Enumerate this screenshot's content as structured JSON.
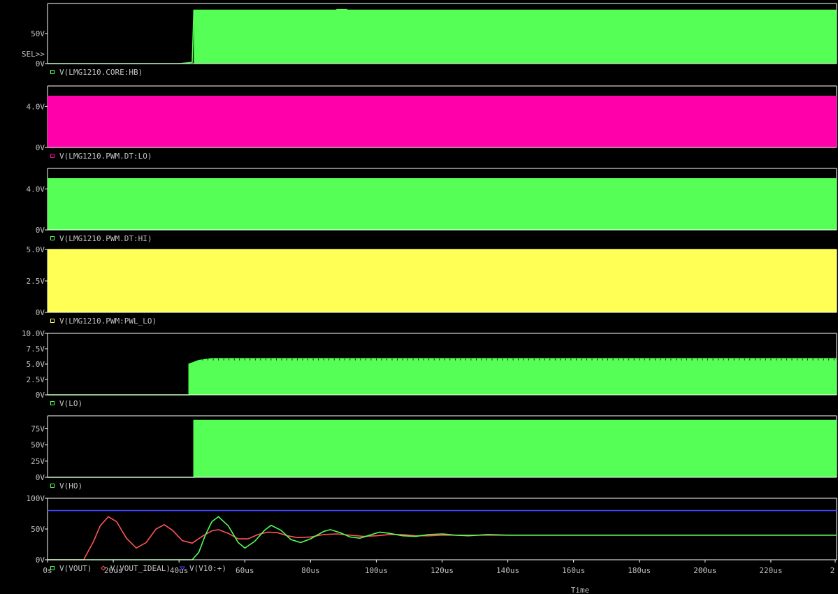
{
  "window": {
    "sel_marker": "SEL>>"
  },
  "x_axis": {
    "title": "Time",
    "ticks": [
      "0s",
      "20us",
      "40us",
      "60us",
      "80us",
      "100us",
      "120us",
      "140us",
      "160us",
      "180us",
      "200us",
      "220us",
      "2"
    ]
  },
  "colors": {
    "background": "#000000",
    "frame": "#ffffff",
    "axis_text": "#c0c0c0",
    "green": "#55ff55",
    "magenta": "#ff00aa",
    "yellow": "#ffff55",
    "red": "#ff5555",
    "blue": "#4444ff"
  },
  "chart_data": [
    {
      "type": "area",
      "ylim": [
        0,
        100
      ],
      "y_ticks": [
        "50V",
        "0V"
      ],
      "y_tick_values": [
        50,
        0
      ],
      "legend": [
        {
          "name": "V(LMG1210.CORE:HB)",
          "color": "green",
          "marker": "square"
        }
      ],
      "series": [
        {
          "name": "V(LMG1210.CORE:HB)",
          "color": "green",
          "envelope": [
            [
              0,
              0
            ],
            [
              40,
              0
            ],
            [
              44,
              2
            ],
            [
              44.5,
              89
            ],
            [
              88,
              89
            ],
            [
              88,
              90
            ],
            [
              91,
              90
            ],
            [
              91,
              89
            ],
            [
              240,
              89
            ]
          ],
          "fill_low": 0,
          "fill_start": 44.5
        }
      ]
    },
    {
      "type": "area",
      "ylim": [
        0,
        6
      ],
      "y_ticks": [
        "4.0V",
        "0V"
      ],
      "y_tick_values": [
        4,
        0
      ],
      "legend": [
        {
          "name": "V(LMG1210.PWM.DT:LO)",
          "color": "magenta",
          "marker": "square"
        }
      ],
      "series": [
        {
          "name": "V(LMG1210.PWM.DT:LO)",
          "color": "magenta",
          "envelope": [
            [
              0,
              5
            ],
            [
              240,
              5
            ]
          ],
          "fill_low": 0,
          "fill_start": 0
        }
      ]
    },
    {
      "type": "area",
      "ylim": [
        0,
        6
      ],
      "y_ticks": [
        "4.0V",
        "0V"
      ],
      "y_tick_values": [
        4,
        0
      ],
      "legend": [
        {
          "name": "V(LMG1210.PWM.DT:HI)",
          "color": "green",
          "marker": "square"
        }
      ],
      "series": [
        {
          "name": "V(LMG1210.PWM.DT:HI)",
          "color": "green",
          "envelope": [
            [
              0,
              5
            ],
            [
              240,
              5
            ]
          ],
          "fill_low": 0,
          "fill_start": 0
        }
      ]
    },
    {
      "type": "area",
      "ylim": [
        0,
        5
      ],
      "y_ticks": [
        "5.0V",
        "2.5V",
        "0V"
      ],
      "y_tick_values": [
        5,
        2.5,
        0
      ],
      "legend": [
        {
          "name": "V(LMG1210.PWM:PWL_LO)",
          "color": "yellow",
          "marker": "square"
        }
      ],
      "series": [
        {
          "name": "V(LMG1210.PWM:PWL_LO)",
          "color": "yellow",
          "envelope": [
            [
              0,
              5
            ],
            [
              240,
              5
            ]
          ],
          "fill_low": 0,
          "fill_start": 0
        }
      ]
    },
    {
      "type": "area",
      "ylim": [
        0,
        10
      ],
      "y_ticks": [
        "10.0V",
        "7.5V",
        "5.0V",
        "2.5V",
        "0V"
      ],
      "y_tick_values": [
        10,
        7.5,
        5,
        2.5,
        0
      ],
      "legend": [
        {
          "name": "V(LO)",
          "color": "green",
          "marker": "square"
        }
      ],
      "series": [
        {
          "name": "V(LO)",
          "color": "green",
          "envelope": [
            [
              0,
              0
            ],
            [
              43,
              0
            ],
            [
              43,
              5
            ],
            [
              46,
              5.6
            ],
            [
              50,
              5.9
            ],
            [
              240,
              5.9
            ]
          ],
          "fill_low": 0,
          "fill_start": 43
        }
      ]
    },
    {
      "type": "area",
      "ylim": [
        0,
        95
      ],
      "y_ticks": [
        "75V",
        "50V",
        "25V",
        "0V"
      ],
      "y_tick_values": [
        75,
        50,
        25,
        0
      ],
      "legend": [
        {
          "name": "V(HO)",
          "color": "green",
          "marker": "square"
        }
      ],
      "series": [
        {
          "name": "V(HO)",
          "color": "green",
          "envelope": [
            [
              0,
              0
            ],
            [
              44.5,
              0
            ],
            [
              44.5,
              88
            ],
            [
              240,
              88
            ]
          ],
          "fill_low": 0,
          "fill_start": 44.5
        }
      ]
    },
    {
      "type": "line",
      "ylim": [
        0,
        100
      ],
      "y_ticks": [
        "100V",
        "50V",
        "0V"
      ],
      "y_tick_values": [
        100,
        50,
        0
      ],
      "legend": [
        {
          "name": "V(VOUT)",
          "color": "green",
          "marker": "square"
        },
        {
          "name": "V(VOUT_IDEAL)",
          "color": "red",
          "marker": "diamond"
        },
        {
          "name": "V(V10:+)",
          "color": "blue",
          "marker": "triangle"
        }
      ],
      "series": [
        {
          "name": "V(V10:+)",
          "color": "blue",
          "points": [
            [
              0,
              80
            ],
            [
              240,
              80
            ]
          ]
        },
        {
          "name": "V(VOUT_IDEAL)",
          "color": "red",
          "points": [
            [
              0,
              0
            ],
            [
              11,
              0
            ],
            [
              14,
              30
            ],
            [
              16,
              55
            ],
            [
              18.5,
              70
            ],
            [
              21,
              62
            ],
            [
              24,
              35
            ],
            [
              27,
              19
            ],
            [
              30,
              28
            ],
            [
              33,
              50
            ],
            [
              35.5,
              57
            ],
            [
              38,
              48
            ],
            [
              41,
              31
            ],
            [
              44,
              27
            ],
            [
              47,
              38
            ],
            [
              50,
              47
            ],
            [
              52,
              49
            ],
            [
              55,
              43
            ],
            [
              58,
              34
            ],
            [
              61,
              34
            ],
            [
              64,
              41
            ],
            [
              67,
              45
            ],
            [
              70,
              44
            ],
            [
              73,
              39
            ],
            [
              76,
              36
            ],
            [
              80,
              37
            ],
            [
              84,
              41
            ],
            [
              88,
              42
            ],
            [
              92,
              40
            ],
            [
              96,
              38
            ],
            [
              100,
              39
            ],
            [
              104,
              41
            ],
            [
              108,
              41
            ],
            [
              112,
              39
            ],
            [
              116,
              39
            ],
            [
              120,
              40
            ],
            [
              130,
              40
            ],
            [
              150,
              40
            ],
            [
              180,
              40
            ],
            [
              240,
              40
            ]
          ]
        },
        {
          "name": "V(VOUT)",
          "color": "green",
          "points": [
            [
              0,
              0
            ],
            [
              44,
              0
            ],
            [
              46,
              12
            ],
            [
              48,
              40
            ],
            [
              50,
              62
            ],
            [
              52,
              70
            ],
            [
              55,
              55
            ],
            [
              58,
              28
            ],
            [
              60,
              19
            ],
            [
              63,
              30
            ],
            [
              66,
              48
            ],
            [
              68,
              56
            ],
            [
              71,
              48
            ],
            [
              74,
              33
            ],
            [
              77,
              28
            ],
            [
              80,
              34
            ],
            [
              84,
              46
            ],
            [
              86,
              49
            ],
            [
              89,
              44
            ],
            [
              92,
              37
            ],
            [
              95,
              35
            ],
            [
              98,
              40
            ],
            [
              101,
              45
            ],
            [
              104,
              43
            ],
            [
              108,
              39
            ],
            [
              112,
              38
            ],
            [
              116,
              41
            ],
            [
              120,
              42
            ],
            [
              124,
              40
            ],
            [
              128,
              39
            ],
            [
              134,
              41
            ],
            [
              140,
              40
            ],
            [
              160,
              40
            ],
            [
              240,
              40
            ]
          ]
        }
      ]
    }
  ]
}
